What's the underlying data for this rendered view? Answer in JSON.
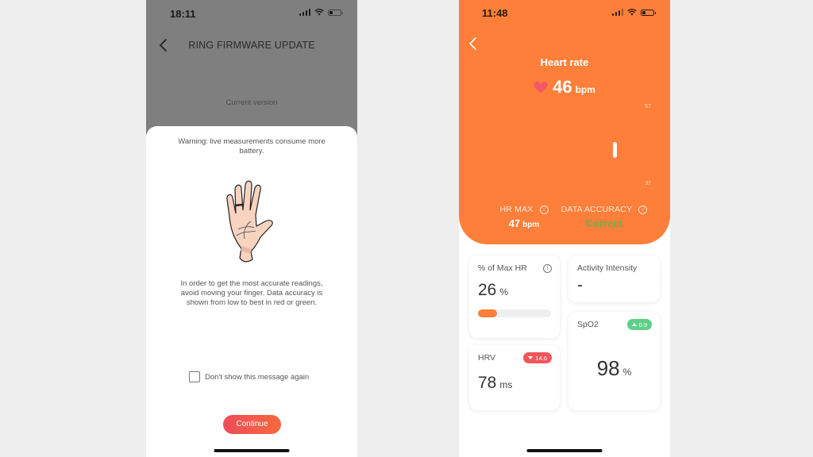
{
  "left_phone": {
    "status_bar": {
      "time": "18:11",
      "icons": [
        "signal-icon",
        "wifi-icon",
        "battery-icon"
      ]
    },
    "nav": {
      "back_icon": "chevron-left-icon",
      "title": "RING FIRMWARE UPDATE"
    },
    "background": {
      "current_version_label": "Current version"
    },
    "sheet": {
      "warning": "Warning: live measurements consume more battery.",
      "illustration": "hand-with-ring-illustration",
      "instructions": "In order to get the most accurate readings, avoid moving your finger. Data accuracy is shown from low to best in red or green.",
      "checkbox_label": "Don't show this message again",
      "checkbox_checked": false,
      "continue_label": "Continue"
    },
    "colors": {
      "overlay": "#7f7f7f",
      "button_start": "#ef4b58",
      "button_end": "#f46a3d"
    }
  },
  "right_phone": {
    "status_bar": {
      "time": "11:48",
      "icons": [
        "signal-icon",
        "wifi-icon",
        "battery-icon"
      ]
    },
    "nav": {
      "back_icon": "chevron-left-icon"
    },
    "header": {
      "title": "Heart rate",
      "heart_icon": "heart-icon",
      "value": "46",
      "unit": "bpm",
      "chart": {
        "y_max_label": "57",
        "y_min_label": "37",
        "y_range": [
          37,
          57
        ],
        "bars": [
          {
            "low": 44,
            "high": 48
          }
        ]
      },
      "hr_max": {
        "label": "HR MAX",
        "value": "47",
        "unit": "bpm"
      },
      "data_accuracy": {
        "label": "DATA ACCURACY",
        "value": "Correct"
      }
    },
    "cards": {
      "max_hr": {
        "title": "% of Max HR",
        "value": "26",
        "unit": "%",
        "progress": 0.26
      },
      "activity": {
        "title": "Activity Intensity",
        "value": "-"
      },
      "spo2": {
        "title": "SpO2",
        "value": "98",
        "unit": "%",
        "badge": "0.9",
        "trend": "up"
      },
      "hrv": {
        "title": "HRV",
        "value": "78",
        "unit": "ms",
        "badge": "14.6",
        "trend": "down"
      }
    },
    "colors": {
      "accent": "#fd7f3a",
      "heart": "#f2576a",
      "accuracy_good": "#6ab04c",
      "badge_up": "#5cd08a",
      "badge_down": "#f2565d",
      "progress": "#fd7f3a"
    }
  }
}
